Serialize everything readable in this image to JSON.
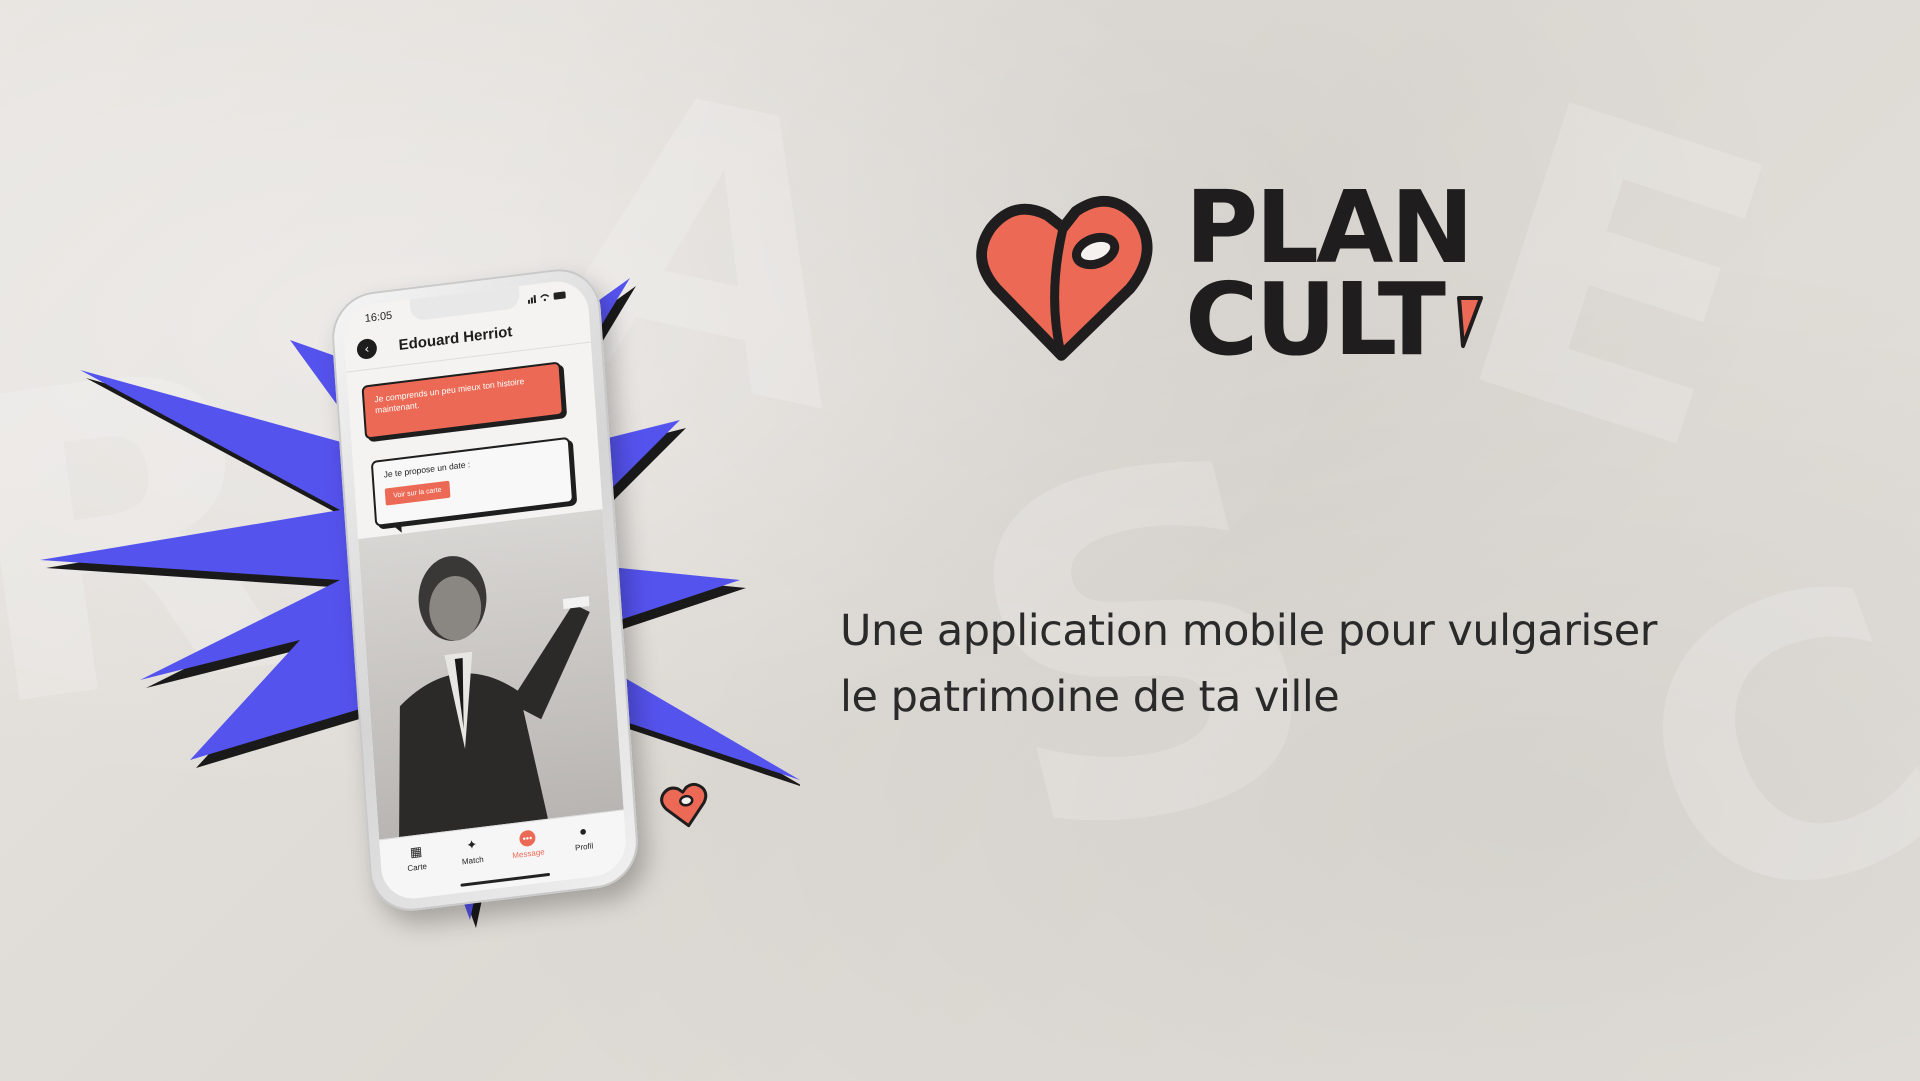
{
  "brand": {
    "name_line1": "PLAN",
    "name_line2": "CULT",
    "accent_color": "#EC6A55",
    "ink_color": "#1F1D1D",
    "burst_color": "#5553EE"
  },
  "tagline": {
    "line1": "Une application mobile pour vulgariser",
    "line2": "le patrimoine de ta ville"
  },
  "phone": {
    "status_time": "16:05",
    "contact_name": "Edouard Herriot",
    "messages": [
      {
        "text": "Je comprends un peu mieux ton histoire maintenant."
      },
      {
        "text": "Je te propose un date :",
        "button_label": "Voir sur la carte"
      }
    ],
    "tabs": [
      {
        "label": "Carte",
        "icon": "map-icon"
      },
      {
        "label": "Match",
        "icon": "sparkle-icon"
      },
      {
        "label": "Message",
        "icon": "message-icon",
        "active": true
      },
      {
        "label": "Profil",
        "icon": "profile-icon"
      }
    ]
  }
}
